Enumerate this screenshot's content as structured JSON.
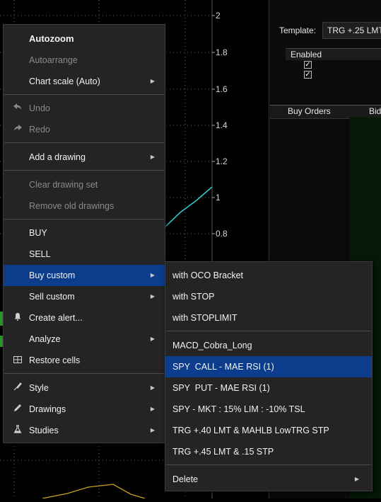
{
  "chart": {
    "y_ticks": [
      "2",
      "1.8",
      "1.6",
      "1.4",
      "1.2",
      "1",
      "0.8"
    ],
    "colors": {
      "price_line": "#33c6c6",
      "study_line": "#c9a21a",
      "grid": "#6a6a6a"
    }
  },
  "right_panel": {
    "template_label": "Template:",
    "template_value": "TRG +.25 LMT",
    "enabled_header": "Enabled",
    "checkbox_mark": "✓",
    "buy_orders_header": "Buy Orders",
    "bid_header": "Bid"
  },
  "context_menu": {
    "items": [
      {
        "label": "Autozoom",
        "bold": true
      },
      {
        "label": "Autoarrange",
        "disabled": true
      },
      {
        "label": "Chart scale (Auto)",
        "submenu": true
      },
      {
        "label": "Undo",
        "disabled": true,
        "icon": "undo-icon"
      },
      {
        "label": "Redo",
        "disabled": true,
        "icon": "redo-icon"
      },
      {
        "label": "Add a drawing",
        "submenu": true
      },
      {
        "label": "Clear drawing set",
        "disabled": true
      },
      {
        "label": "Remove old drawings",
        "disabled": true
      },
      {
        "label": "BUY"
      },
      {
        "label": "SELL"
      },
      {
        "label": "Buy custom",
        "submenu": true,
        "highlighted": true
      },
      {
        "label": "Sell custom",
        "submenu": true
      },
      {
        "label": "Create alert...",
        "icon": "bell-icon"
      },
      {
        "label": "Analyze",
        "submenu": true
      },
      {
        "label": "Restore cells",
        "icon": "restore-cells-icon"
      },
      {
        "label": "Style",
        "submenu": true,
        "icon": "style-icon"
      },
      {
        "label": "Drawings",
        "submenu": true,
        "icon": "pencil-icon"
      },
      {
        "label": "Studies",
        "submenu": true,
        "icon": "flask-icon"
      }
    ]
  },
  "buy_custom_submenu": {
    "items": [
      {
        "label": "with OCO Bracket"
      },
      {
        "label": "with STOP"
      },
      {
        "label": "with STOPLIMIT"
      },
      {
        "label": "MACD_Cobra_Long"
      },
      {
        "label": "SPY  CALL - MAE RSI (1)",
        "highlighted": true
      },
      {
        "label": "SPY  PUT - MAE RSI (1)"
      },
      {
        "label": "SPY - MKT : 15% LIM : -10% TSL"
      },
      {
        "label": "TRG +.40 LMT & MAHLB LowTRG STP"
      },
      {
        "label": "TRG +.45 LMT & .15 STP"
      },
      {
        "label": "Delete",
        "submenu": true
      }
    ]
  },
  "glyphs": {
    "submenu_arrow": "▶"
  }
}
